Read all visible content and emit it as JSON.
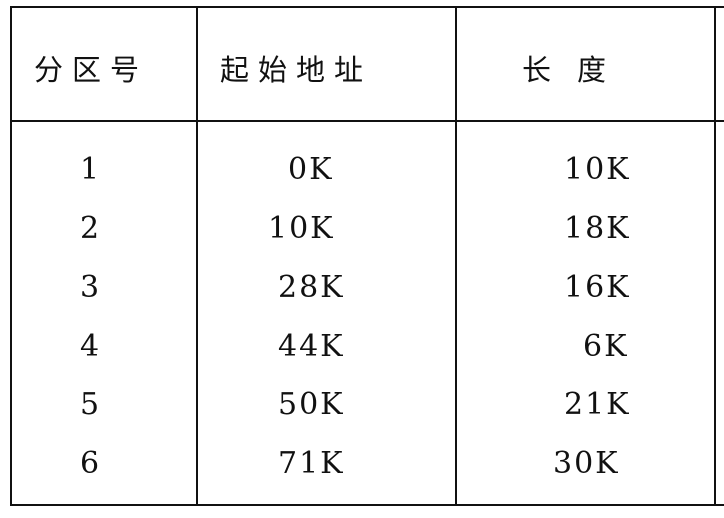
{
  "table": {
    "headers": [
      "分区号",
      "起始地址",
      "长度"
    ],
    "rows": [
      {
        "partition": "1",
        "start": "0K",
        "length": "10K"
      },
      {
        "partition": "2",
        "start": "10K",
        "length": "18K"
      },
      {
        "partition": "3",
        "start": "28K",
        "length": "16K"
      },
      {
        "partition": "4",
        "start": "44K",
        "length": "6K"
      },
      {
        "partition": "5",
        "start": "50K",
        "length": "21K"
      },
      {
        "partition": "6",
        "start": "71K",
        "length": "30K"
      }
    ]
  }
}
